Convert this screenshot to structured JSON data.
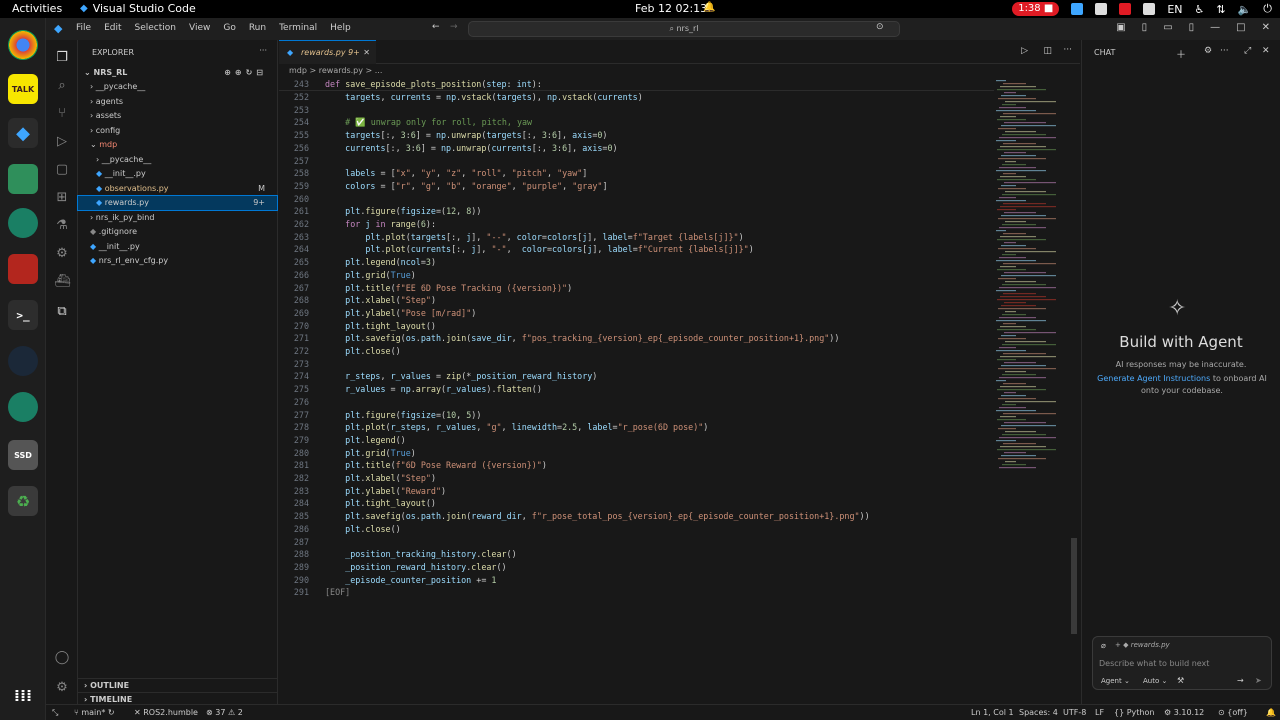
{
  "topbar": {
    "activities": "Activities",
    "app_name": "Visual Studio Code",
    "clock": "Feb 12  02:13",
    "record": "1:38",
    "lang": "EN"
  },
  "titlebar": {
    "menu": [
      "File",
      "Edit",
      "Selection",
      "View",
      "Go",
      "Run",
      "Terminal",
      "Help"
    ],
    "search": "nrs_rl"
  },
  "explorer": {
    "header": "EXPLORER",
    "root": "NRS_RL",
    "items": [
      {
        "label": "__pycache__",
        "depth": 1,
        "kind": "folder"
      },
      {
        "label": "agents",
        "depth": 1,
        "kind": "folder"
      },
      {
        "label": "assets",
        "depth": 1,
        "kind": "folder"
      },
      {
        "label": "config",
        "depth": 1,
        "kind": "folder"
      },
      {
        "label": "mdp",
        "depth": 1,
        "kind": "folder-open"
      },
      {
        "label": "__pycache__",
        "depth": 2,
        "kind": "folder"
      },
      {
        "label": "__init__.py",
        "depth": 2,
        "kind": "file"
      },
      {
        "label": "observations.py",
        "depth": 2,
        "kind": "file-mod",
        "badge": "M"
      },
      {
        "label": "rewards.py",
        "depth": 2,
        "kind": "file-sel",
        "badge": "9+"
      },
      {
        "label": "nrs_ik_py_bind",
        "depth": 1,
        "kind": "folder"
      },
      {
        "label": ".gitignore",
        "depth": 1,
        "kind": "file"
      },
      {
        "label": "__init__.py",
        "depth": 1,
        "kind": "file"
      },
      {
        "label": "nrs_rl_env_cfg.py",
        "depth": 1,
        "kind": "file"
      }
    ],
    "outline": "OUTLINE",
    "timeline": "TIMELINE"
  },
  "editor": {
    "tab_label": "rewards.py",
    "tab_badge": "9+",
    "breadcrumb": "mdp  >  rewards.py  >  ...",
    "sticky": {
      "ln": "243",
      "code": "def save_episode_plots_position(step: int):"
    },
    "lines": [
      {
        "ln": "252",
        "code": "    targets, currents = np.vstack(targets), np.vstack(currents)"
      },
      {
        "ln": "253",
        "code": ""
      },
      {
        "ln": "254",
        "code": "    # ✅ unwrap only for roll, pitch, yaw"
      },
      {
        "ln": "255",
        "code": "    targets[:, 3:6] = np.unwrap(targets[:, 3:6], axis=0)"
      },
      {
        "ln": "256",
        "code": "    currents[:, 3:6] = np.unwrap(currents[:, 3:6], axis=0)"
      },
      {
        "ln": "257",
        "code": ""
      },
      {
        "ln": "258",
        "code": "    labels = [\"x\", \"y\", \"z\", \"roll\", \"pitch\", \"yaw\"]"
      },
      {
        "ln": "259",
        "code": "    colors = [\"r\", \"g\", \"b\", \"orange\", \"purple\", \"gray\"]"
      },
      {
        "ln": "260",
        "code": ""
      },
      {
        "ln": "261",
        "code": "    plt.figure(figsize=(12, 8))"
      },
      {
        "ln": "262",
        "code": "    for j in range(6):"
      },
      {
        "ln": "263",
        "code": "        plt.plot(targets[:, j], \"--\", color=colors[j], label=f\"Target {labels[j]}\")"
      },
      {
        "ln": "264",
        "code": "        plt.plot(currents[:, j], \"-\",  color=colors[j], label=f\"Current {labels[j]}\")"
      },
      {
        "ln": "265",
        "code": "    plt.legend(ncol=3)"
      },
      {
        "ln": "266",
        "code": "    plt.grid(True)"
      },
      {
        "ln": "267",
        "code": "    plt.title(f\"EE 6D Pose Tracking ({version})\")"
      },
      {
        "ln": "268",
        "code": "    plt.xlabel(\"Step\")"
      },
      {
        "ln": "269",
        "code": "    plt.ylabel(\"Pose [m/rad]\")"
      },
      {
        "ln": "270",
        "code": "    plt.tight_layout()"
      },
      {
        "ln": "271",
        "code": "    plt.savefig(os.path.join(save_dir, f\"pos_tracking_{version}_ep{_episode_counter_position+1}.png\"))"
      },
      {
        "ln": "272",
        "code": "    plt.close()"
      },
      {
        "ln": "273",
        "code": ""
      },
      {
        "ln": "274",
        "code": "    r_steps, r_values = zip(*_position_reward_history)"
      },
      {
        "ln": "275",
        "code": "    r_values = np.array(r_values).flatten()"
      },
      {
        "ln": "276",
        "code": ""
      },
      {
        "ln": "277",
        "code": "    plt.figure(figsize=(10, 5))"
      },
      {
        "ln": "278",
        "code": "    plt.plot(r_steps, r_values, \"g\", linewidth=2.5, label=\"r_pose(6D pose)\")"
      },
      {
        "ln": "279",
        "code": "    plt.legend()"
      },
      {
        "ln": "280",
        "code": "    plt.grid(True)"
      },
      {
        "ln": "281",
        "code": "    plt.title(f\"6D Pose Reward ({version})\")"
      },
      {
        "ln": "282",
        "code": "    plt.xlabel(\"Step\")"
      },
      {
        "ln": "283",
        "code": "    plt.ylabel(\"Reward\")"
      },
      {
        "ln": "284",
        "code": "    plt.tight_layout()"
      },
      {
        "ln": "285",
        "code": "    plt.savefig(os.path.join(reward_dir, f\"r_pose_total_pos_{version}_ep{_episode_counter_position+1}.png\"))"
      },
      {
        "ln": "286",
        "code": "    plt.close()"
      },
      {
        "ln": "287",
        "code": ""
      },
      {
        "ln": "288",
        "code": "    _position_tracking_history.clear()"
      },
      {
        "ln": "289",
        "code": "    _position_reward_history.clear()"
      },
      {
        "ln": "290",
        "code": "    _episode_counter_position += 1"
      },
      {
        "ln": "291",
        "code": "[EOF]"
      }
    ]
  },
  "chat": {
    "header": "CHAT",
    "title": "Build with Agent",
    "subtitle": "AI responses may be inaccurate.",
    "link": "Generate Agent Instructions",
    "link_rest": " to onboard AI onto your codebase.",
    "context_file": "rewards.py",
    "input_placeholder": "Describe what to build next",
    "mode": "Agent",
    "model": "Auto"
  },
  "status": {
    "branch": "main*",
    "ros": "ROS2.humble",
    "errors": "37",
    "warnings": "2",
    "position": "Ln 1, Col 1",
    "spaces": "Spaces: 4",
    "encoding": "UTF-8",
    "eol": "LF",
    "language": "Python",
    "version": "3.10.12",
    "off": "{off}"
  },
  "colors": {
    "accent": "#0078d4",
    "selection": "#04395e",
    "modified": "#e2c08d",
    "record": "#e01b24"
  }
}
